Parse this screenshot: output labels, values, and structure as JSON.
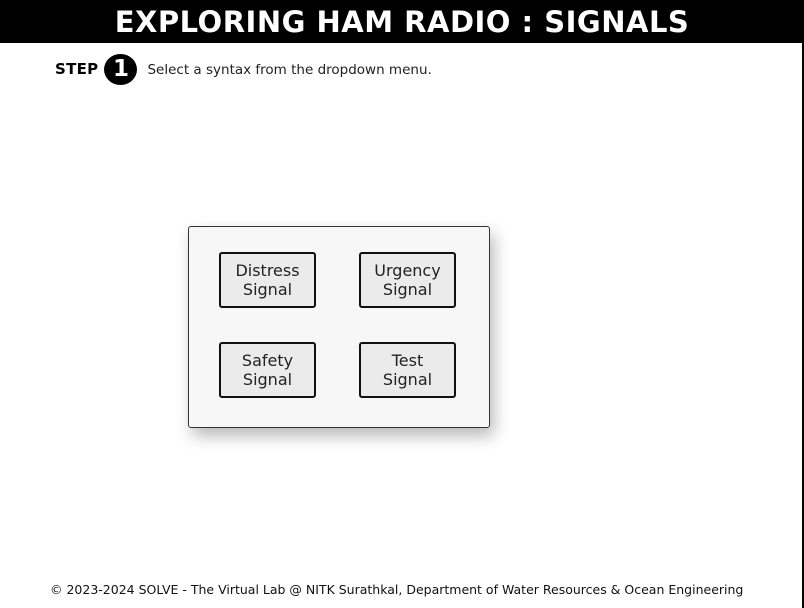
{
  "header": {
    "title": "EXPLORING HAM RADIO : SIGNALS"
  },
  "step": {
    "label": "STEP",
    "number": "1",
    "instruction": "Select a syntax from the dropdown menu."
  },
  "signals": {
    "distress": "Distress\nSignal",
    "urgency": "Urgency\nSignal",
    "safety": "Safety\nSignal",
    "test": "Test\nSignal"
  },
  "footer": {
    "text": "© 2023-2024 SOLVE - The Virtual Lab @ NITK Surathkal, Department of Water Resources & Ocean Engineering"
  }
}
